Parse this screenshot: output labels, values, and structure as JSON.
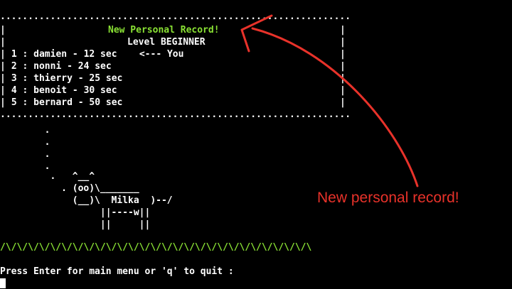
{
  "terminal": {
    "top_border": "...............................................................",
    "rows": [
      {
        "left": "|",
        "text": "New Personal Record!",
        "right": "|"
      },
      {
        "left": "|",
        "text": "Level BEGINNER",
        "right": "|"
      },
      {
        "left": "|",
        "text": " 1 : damien - 12 sec    <--- You",
        "right": "|"
      },
      {
        "left": "|",
        "text": " 2 : nonni - 24 sec",
        "right": "|"
      },
      {
        "left": "|",
        "text": " 3 : thierry - 25 sec",
        "right": "|"
      },
      {
        "left": "|",
        "text": " 4 : benoit - 30 sec",
        "right": "|"
      },
      {
        "left": "|",
        "text": " 5 : bernard - 50 sec",
        "right": "|"
      }
    ],
    "bottom_border": "...............................................................",
    "cow": [
      "        .",
      "        .",
      "        .",
      "        .",
      "         .   ^__^",
      "           . (oo)\\_______",
      "             (__)\\  Milka  )--/",
      "                  ||----w||",
      "                  ||     ||"
    ],
    "grass": "/\\/\\/\\/\\/\\/\\/\\/\\/\\/\\/\\/\\/\\/\\/\\/\\/\\/\\/\\/\\/\\/\\/\\/\\/\\/\\/\\/\\",
    "prompt": "Press Enter for main menu or 'q' to quit : "
  },
  "annotation": {
    "text": "New personal record!",
    "color": "#e8322a"
  },
  "colors": {
    "highlight_green": "#8ae234",
    "background": "#000000",
    "text": "#ffffff"
  }
}
